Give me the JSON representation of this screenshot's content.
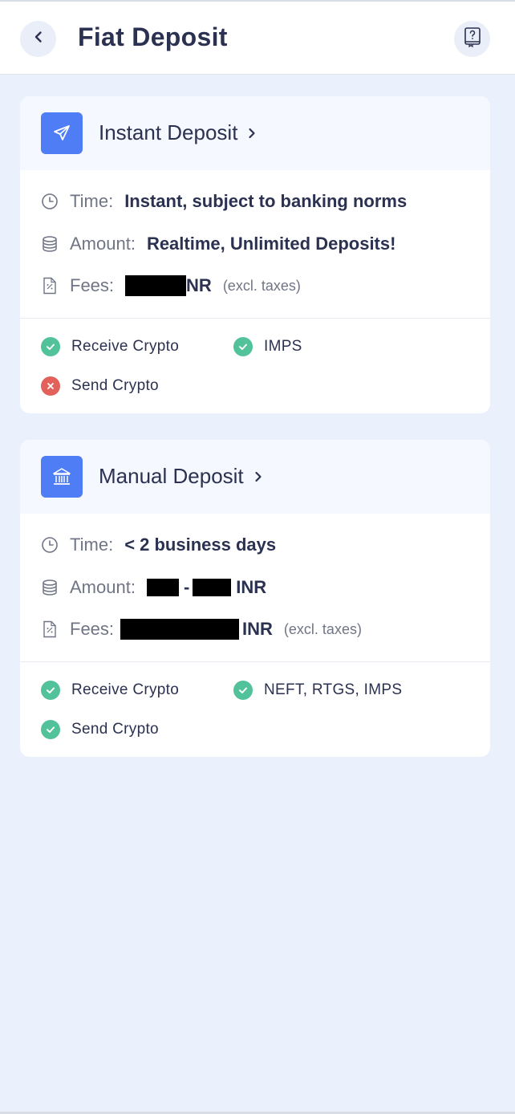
{
  "header": {
    "title": "Fiat Deposit",
    "back_icon": "chevron-left-icon",
    "help_icon": "help-book-icon"
  },
  "colors": {
    "accent": "#4e7df5",
    "success": "#52c29a",
    "error": "#e2615a",
    "background": "#eaf1fc"
  },
  "instant": {
    "title": "Instant Deposit",
    "icon": "paper-plane-icon",
    "time_label": "Time:",
    "time_value": "Instant, subject to banking norms",
    "amount_label": "Amount:",
    "amount_value": "Realtime, Unlimited Deposits!",
    "fees_label": "Fees:",
    "fees_value_suffix": "NR",
    "fees_note": "(excl. taxes)",
    "features": [
      {
        "label": "Receive Crypto",
        "status": "ok"
      },
      {
        "label": "IMPS",
        "status": "ok"
      },
      {
        "label": "Send Crypto",
        "status": "not-available"
      }
    ]
  },
  "manual": {
    "title": "Manual Deposit",
    "icon": "bank-icon",
    "time_label": "Time:",
    "time_value": "< 2 business days",
    "amount_label": "Amount:",
    "amount_separator": "-",
    "amount_suffix": "INR",
    "fees_label": "Fees:",
    "fees_value_suffix": "INR",
    "fees_note": "(excl. taxes)",
    "features": [
      {
        "label": "Receive Crypto",
        "status": "ok"
      },
      {
        "label": "NEFT, RTGS, IMPS",
        "status": "ok"
      },
      {
        "label": "Send Crypto",
        "status": "ok"
      }
    ]
  }
}
